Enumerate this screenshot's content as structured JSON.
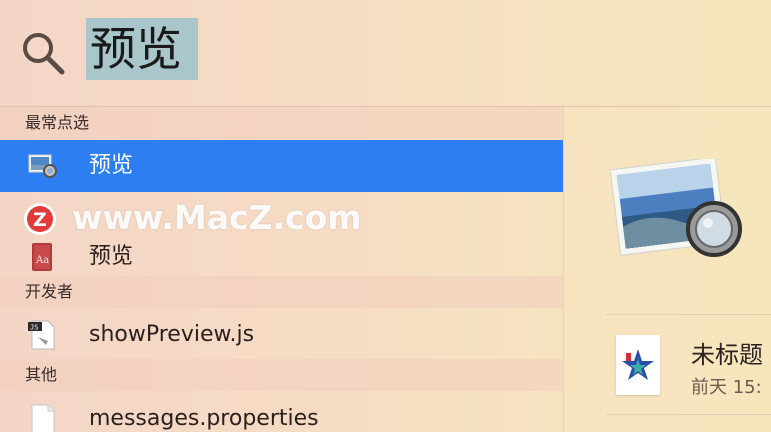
{
  "search": {
    "query": "预览"
  },
  "sections": {
    "top_hits": "最常点选",
    "developer": "开发者",
    "other": "其他"
  },
  "results": {
    "top_hit_label": "预览",
    "dictionary_label": "预览",
    "developer_item": "showPreview.js",
    "other_item": "messages.properties"
  },
  "watermark": {
    "text": "www.MacZ.com",
    "logo_letter": "Z"
  },
  "preview_panel": {
    "doc_title": "未标题",
    "doc_date": "前天 15:"
  },
  "icons": {
    "search": "search-icon",
    "preview_app": "preview-app-icon",
    "dictionary": "dictionary-icon",
    "js_file": "js-file-icon",
    "generic_file": "file-icon"
  },
  "colors": {
    "selection": "#2d7ef0",
    "query_highlight": "#a9c6cb"
  }
}
